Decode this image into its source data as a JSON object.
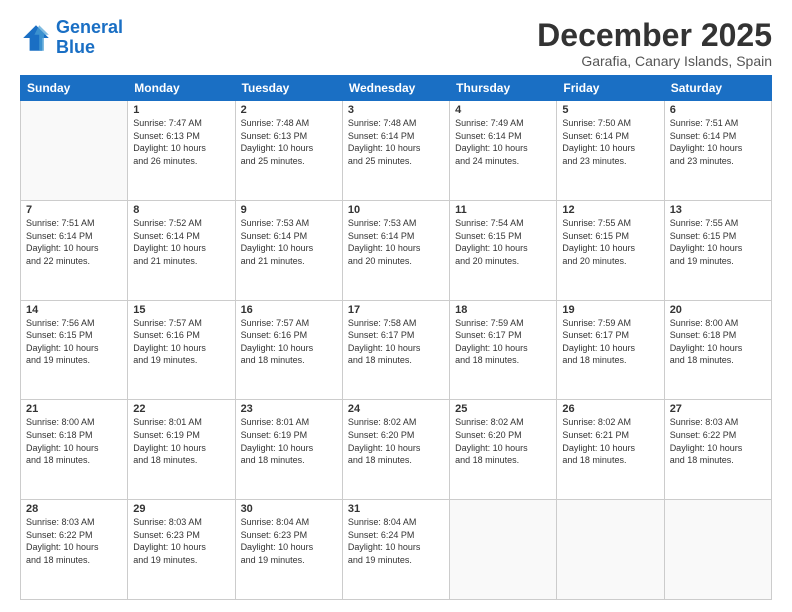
{
  "header": {
    "logo_line1": "General",
    "logo_line2": "Blue",
    "title": "December 2025",
    "subtitle": "Garafia, Canary Islands, Spain"
  },
  "calendar": {
    "days_of_week": [
      "Sunday",
      "Monday",
      "Tuesday",
      "Wednesday",
      "Thursday",
      "Friday",
      "Saturday"
    ],
    "weeks": [
      [
        {
          "day": "",
          "info": ""
        },
        {
          "day": "1",
          "info": "Sunrise: 7:47 AM\nSunset: 6:13 PM\nDaylight: 10 hours\nand 26 minutes."
        },
        {
          "day": "2",
          "info": "Sunrise: 7:48 AM\nSunset: 6:13 PM\nDaylight: 10 hours\nand 25 minutes."
        },
        {
          "day": "3",
          "info": "Sunrise: 7:48 AM\nSunset: 6:14 PM\nDaylight: 10 hours\nand 25 minutes."
        },
        {
          "day": "4",
          "info": "Sunrise: 7:49 AM\nSunset: 6:14 PM\nDaylight: 10 hours\nand 24 minutes."
        },
        {
          "day": "5",
          "info": "Sunrise: 7:50 AM\nSunset: 6:14 PM\nDaylight: 10 hours\nand 23 minutes."
        },
        {
          "day": "6",
          "info": "Sunrise: 7:51 AM\nSunset: 6:14 PM\nDaylight: 10 hours\nand 23 minutes."
        }
      ],
      [
        {
          "day": "7",
          "info": "Sunrise: 7:51 AM\nSunset: 6:14 PM\nDaylight: 10 hours\nand 22 minutes."
        },
        {
          "day": "8",
          "info": "Sunrise: 7:52 AM\nSunset: 6:14 PM\nDaylight: 10 hours\nand 21 minutes."
        },
        {
          "day": "9",
          "info": "Sunrise: 7:53 AM\nSunset: 6:14 PM\nDaylight: 10 hours\nand 21 minutes."
        },
        {
          "day": "10",
          "info": "Sunrise: 7:53 AM\nSunset: 6:14 PM\nDaylight: 10 hours\nand 20 minutes."
        },
        {
          "day": "11",
          "info": "Sunrise: 7:54 AM\nSunset: 6:15 PM\nDaylight: 10 hours\nand 20 minutes."
        },
        {
          "day": "12",
          "info": "Sunrise: 7:55 AM\nSunset: 6:15 PM\nDaylight: 10 hours\nand 20 minutes."
        },
        {
          "day": "13",
          "info": "Sunrise: 7:55 AM\nSunset: 6:15 PM\nDaylight: 10 hours\nand 19 minutes."
        }
      ],
      [
        {
          "day": "14",
          "info": "Sunrise: 7:56 AM\nSunset: 6:15 PM\nDaylight: 10 hours\nand 19 minutes."
        },
        {
          "day": "15",
          "info": "Sunrise: 7:57 AM\nSunset: 6:16 PM\nDaylight: 10 hours\nand 19 minutes."
        },
        {
          "day": "16",
          "info": "Sunrise: 7:57 AM\nSunset: 6:16 PM\nDaylight: 10 hours\nand 18 minutes."
        },
        {
          "day": "17",
          "info": "Sunrise: 7:58 AM\nSunset: 6:17 PM\nDaylight: 10 hours\nand 18 minutes."
        },
        {
          "day": "18",
          "info": "Sunrise: 7:59 AM\nSunset: 6:17 PM\nDaylight: 10 hours\nand 18 minutes."
        },
        {
          "day": "19",
          "info": "Sunrise: 7:59 AM\nSunset: 6:17 PM\nDaylight: 10 hours\nand 18 minutes."
        },
        {
          "day": "20",
          "info": "Sunrise: 8:00 AM\nSunset: 6:18 PM\nDaylight: 10 hours\nand 18 minutes."
        }
      ],
      [
        {
          "day": "21",
          "info": "Sunrise: 8:00 AM\nSunset: 6:18 PM\nDaylight: 10 hours\nand 18 minutes."
        },
        {
          "day": "22",
          "info": "Sunrise: 8:01 AM\nSunset: 6:19 PM\nDaylight: 10 hours\nand 18 minutes."
        },
        {
          "day": "23",
          "info": "Sunrise: 8:01 AM\nSunset: 6:19 PM\nDaylight: 10 hours\nand 18 minutes."
        },
        {
          "day": "24",
          "info": "Sunrise: 8:02 AM\nSunset: 6:20 PM\nDaylight: 10 hours\nand 18 minutes."
        },
        {
          "day": "25",
          "info": "Sunrise: 8:02 AM\nSunset: 6:20 PM\nDaylight: 10 hours\nand 18 minutes."
        },
        {
          "day": "26",
          "info": "Sunrise: 8:02 AM\nSunset: 6:21 PM\nDaylight: 10 hours\nand 18 minutes."
        },
        {
          "day": "27",
          "info": "Sunrise: 8:03 AM\nSunset: 6:22 PM\nDaylight: 10 hours\nand 18 minutes."
        }
      ],
      [
        {
          "day": "28",
          "info": "Sunrise: 8:03 AM\nSunset: 6:22 PM\nDaylight: 10 hours\nand 18 minutes."
        },
        {
          "day": "29",
          "info": "Sunrise: 8:03 AM\nSunset: 6:23 PM\nDaylight: 10 hours\nand 19 minutes."
        },
        {
          "day": "30",
          "info": "Sunrise: 8:04 AM\nSunset: 6:23 PM\nDaylight: 10 hours\nand 19 minutes."
        },
        {
          "day": "31",
          "info": "Sunrise: 8:04 AM\nSunset: 6:24 PM\nDaylight: 10 hours\nand 19 minutes."
        },
        {
          "day": "",
          "info": ""
        },
        {
          "day": "",
          "info": ""
        },
        {
          "day": "",
          "info": ""
        }
      ]
    ]
  }
}
